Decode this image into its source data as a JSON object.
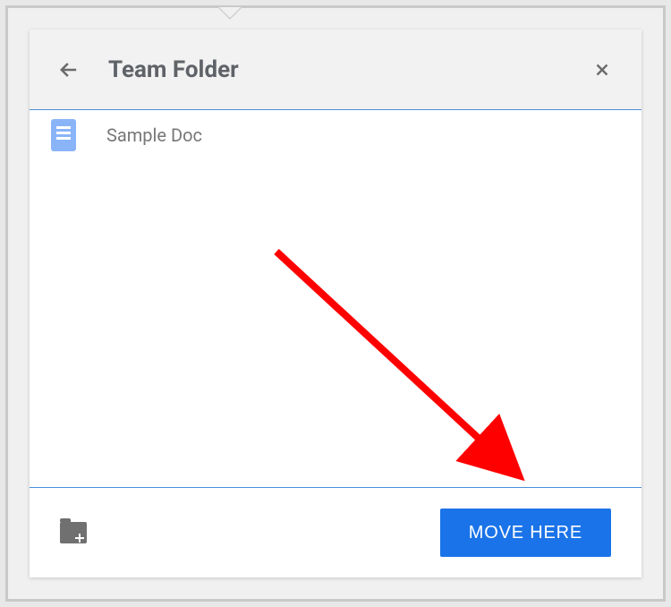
{
  "header": {
    "title": "Team Folder"
  },
  "files": [
    {
      "name": "Sample Doc",
      "icon": "doc"
    }
  ],
  "footer": {
    "move_label": "MOVE HERE"
  }
}
